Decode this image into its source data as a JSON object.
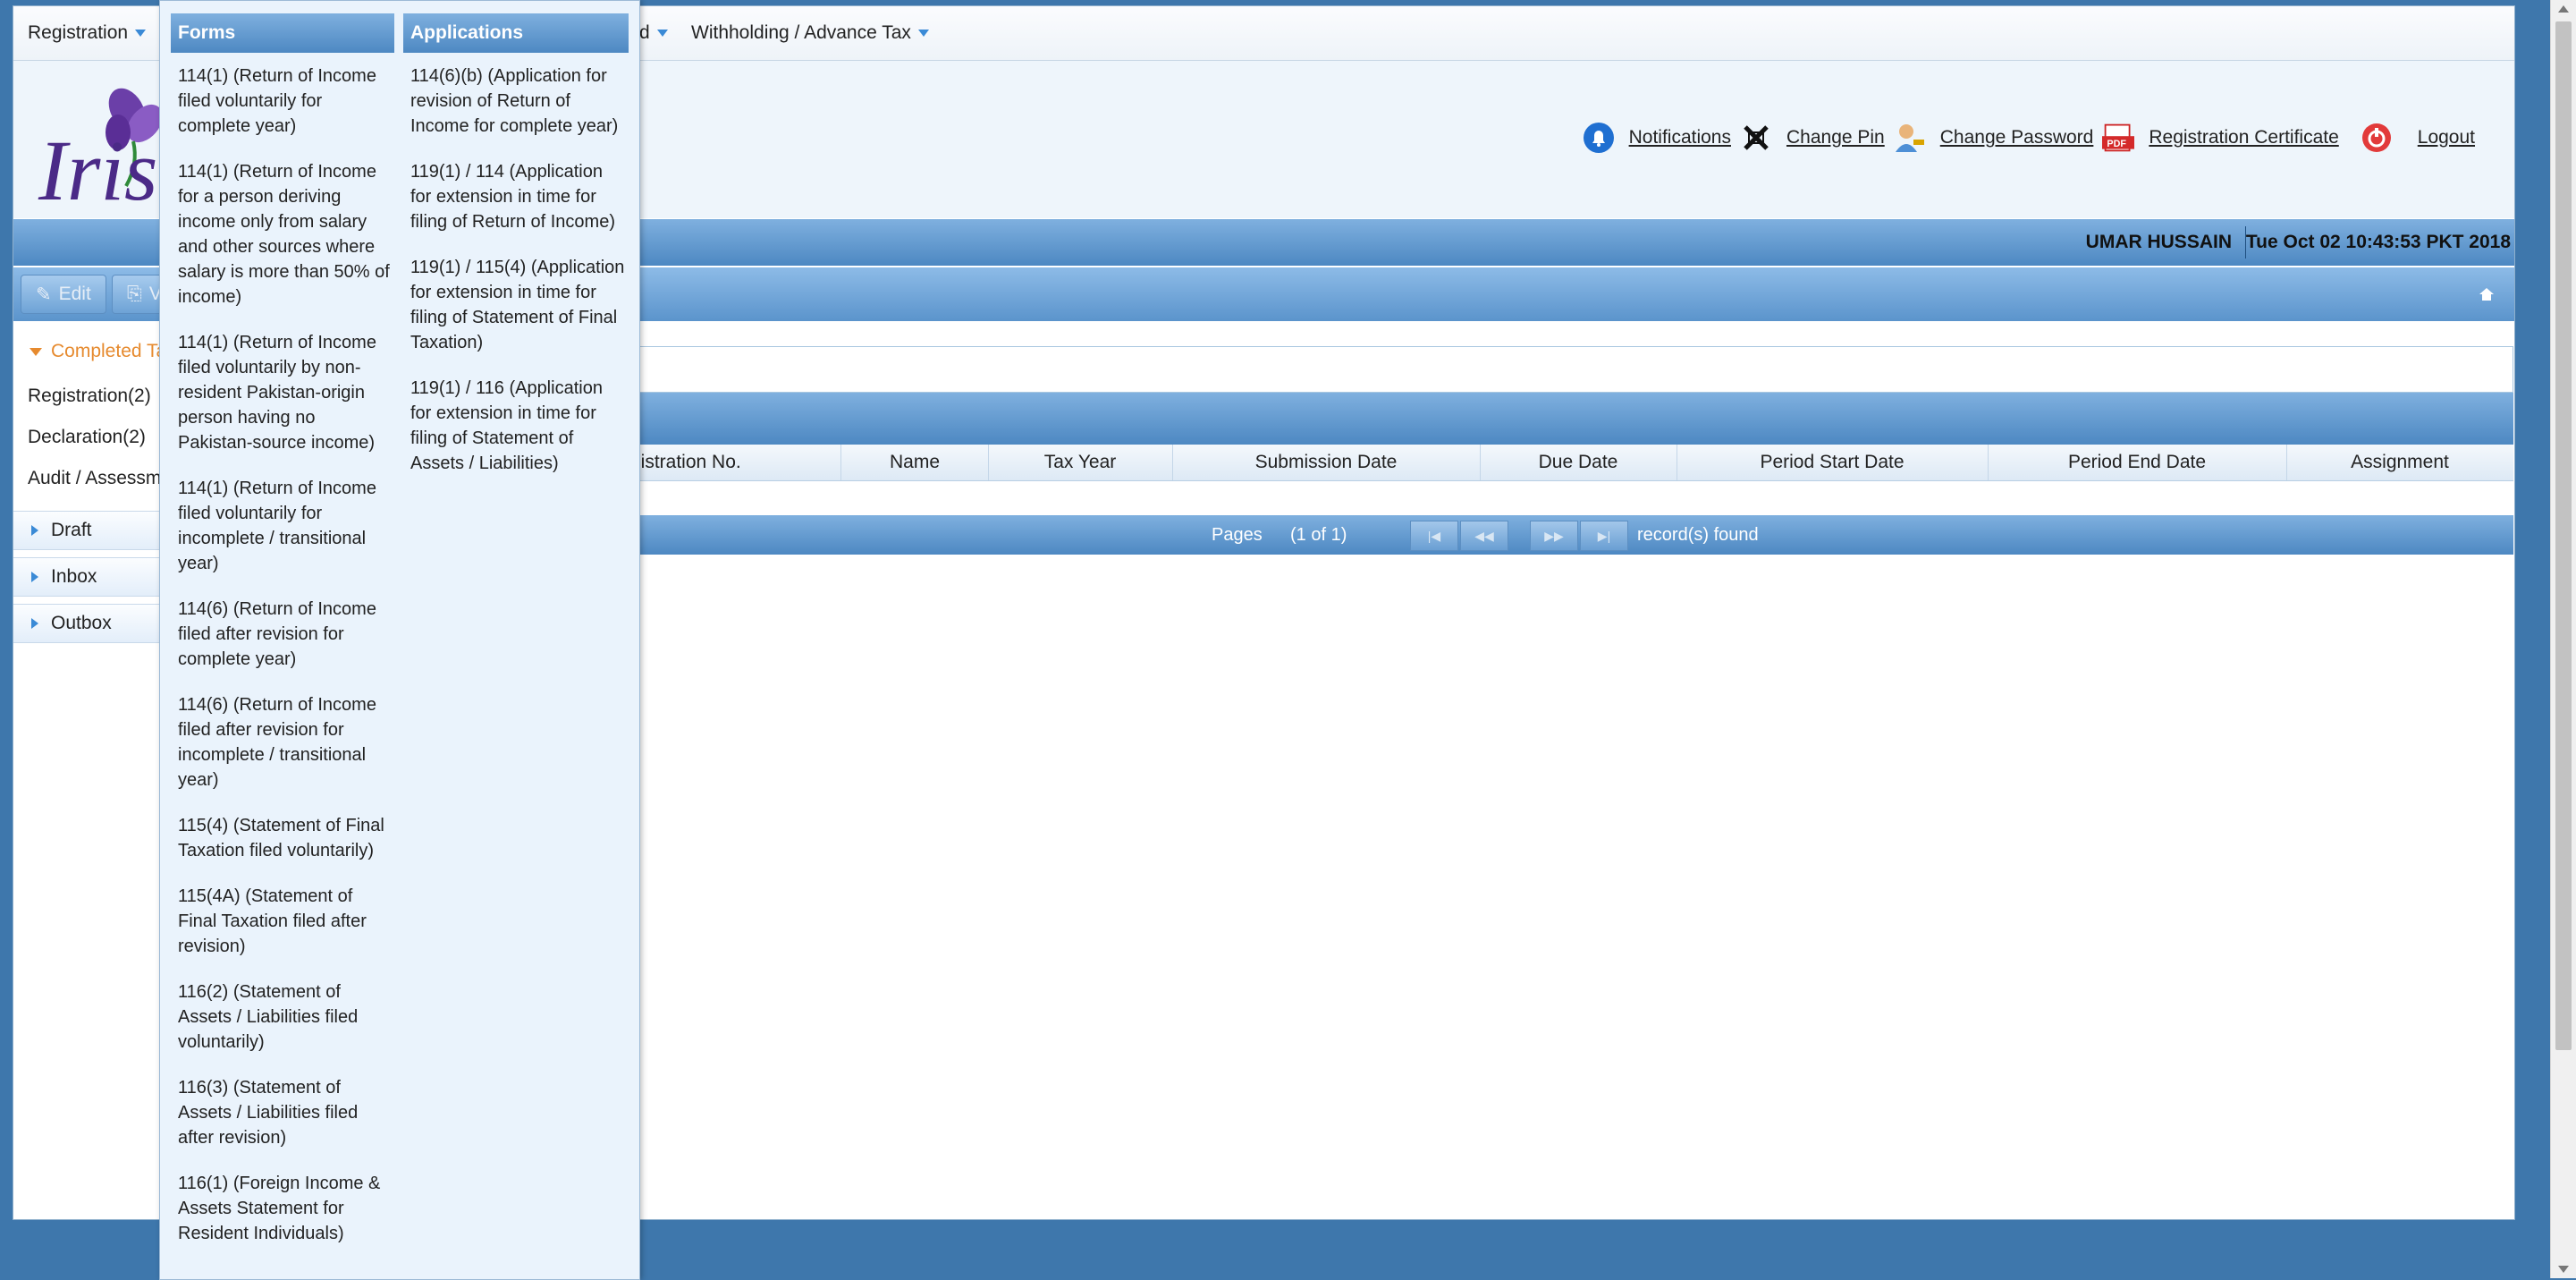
{
  "menubar": {
    "registration": "Registration",
    "partial_hidden": "d",
    "withholding": "Withholding / Advance Tax"
  },
  "header": {
    "logo_text": "Iris",
    "notifications": "Notifications",
    "change_pin": "Change Pin",
    "change_password": "Change Password",
    "registration_certificate": "Registration Certificate",
    "logout": "Logout",
    "pdf_badge": "PDF"
  },
  "userbar": {
    "name": "UMAR HUSSAIN",
    "datetime": "Tue Oct 02 10:43:53 PKT 2018"
  },
  "toolbar": {
    "edit": "Edit",
    "view_partial": "V"
  },
  "leftpanel": {
    "completed": "Completed Ta",
    "registration": "Registration(2)",
    "declaration": "Declaration(2)",
    "audit": "Audit / Assessme",
    "draft": "Draft",
    "inbox": "Inbox",
    "outbox": "Outbox"
  },
  "grid": {
    "columns": [
      "gistration No.",
      "Name",
      "Tax Year",
      "Submission Date",
      "Due Date",
      "Period Start Date",
      "Period End Date",
      "Assignment"
    ],
    "pages_label": "Pages",
    "pages_value": "(1 of 1)",
    "records_found": "record(s) found"
  },
  "dropdown": {
    "forms_title": "Forms",
    "applications_title": "Applications",
    "forms": [
      "114(1) (Return of Income filed voluntarily for complete year)",
      "114(1) (Return of Income for a person deriving income only from salary and other sources where salary is more than 50% of income)",
      "114(1) (Return of Income filed voluntarily by non-resident Pakistan-origin person having no Pakistan-source income)",
      "114(1) (Return of Income filed voluntarily for incomplete / transitional year)",
      "114(6) (Return of Income filed after revision for complete year)",
      "114(6) (Return of Income filed after revision for incomplete / transitional year)",
      "115(4) (Statement of Final Taxation filed voluntarily)",
      "115(4A) (Statement of Final Taxation filed after revision)",
      "116(2) (Statement of Assets / Liabilities filed voluntarily)",
      "116(3) (Statement of Assets / Liabilities filed after revision)",
      "116(1) (Foreign Income & Assets Statement for Resident Individuals)"
    ],
    "applications": [
      "114(6)(b) (Application for revision of Return of Income for complete year)",
      "119(1) / 114 (Application for extension in time for filing of Return of Income)",
      "119(1) / 115(4) (Application for extension in time for filing of Statement of Final Taxation)",
      "119(1) / 116 (Application for extension in time for filing of Statement of Assets / Liabilities)"
    ]
  },
  "colors": {
    "band_blue": "#4d88c2",
    "accent_orange": "#e68a2e",
    "desktop_blue": "#3e77ac"
  }
}
